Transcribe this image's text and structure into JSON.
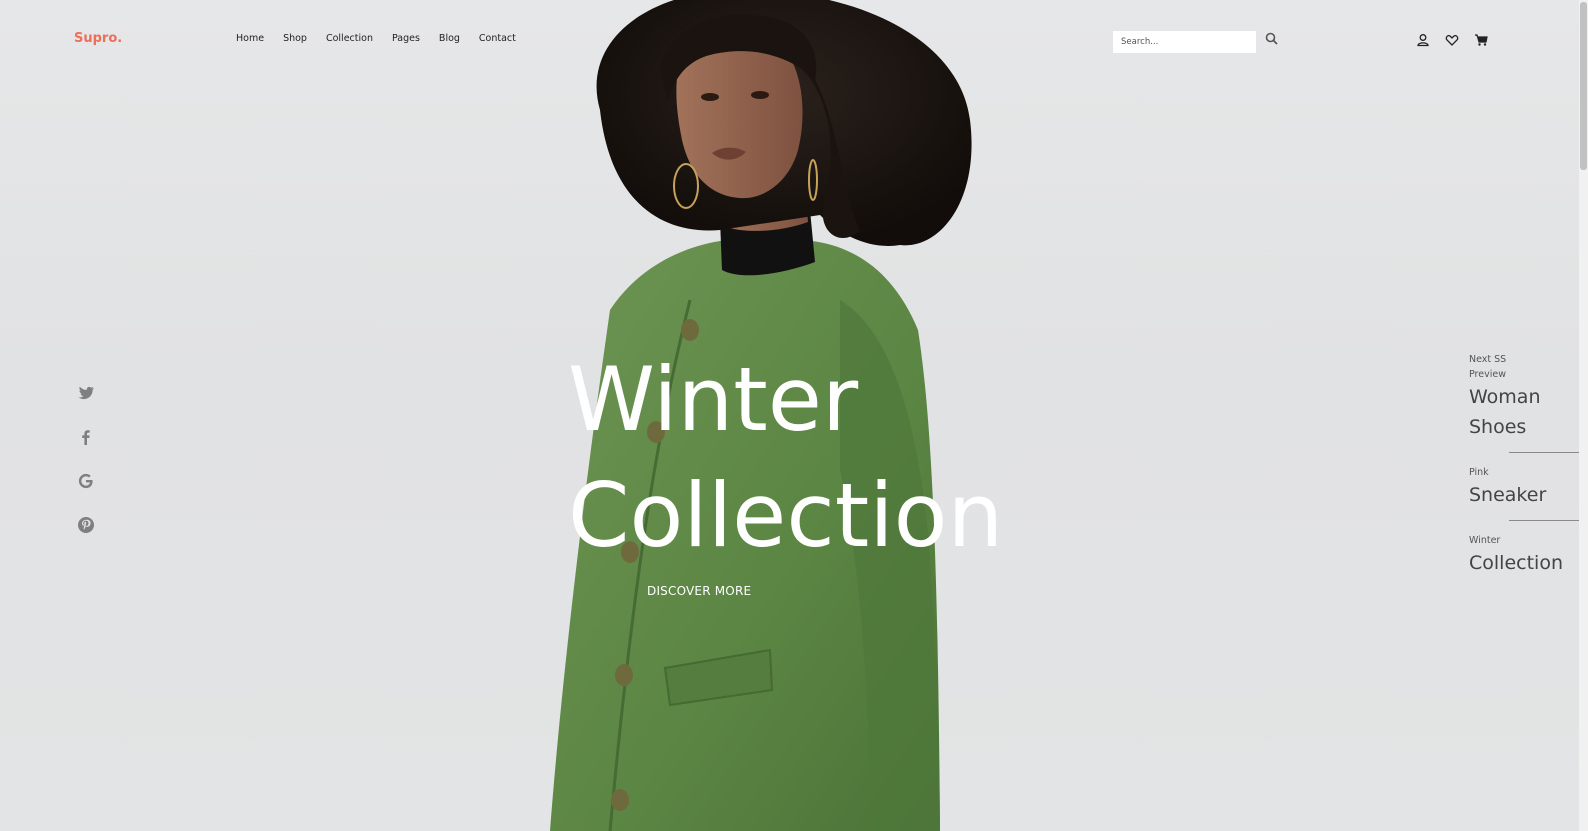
{
  "header": {
    "logo": "Supro.",
    "nav": [
      "Home",
      "Shop",
      "Collection",
      "Pages",
      "Blog",
      "Contact"
    ],
    "search_placeholder": "Search...",
    "icons": [
      "user-icon",
      "heart-icon",
      "cart-icon"
    ]
  },
  "social": {
    "icons": [
      "twitter-icon",
      "facebook-icon",
      "google-icon",
      "pinterest-icon"
    ]
  },
  "hero": {
    "title_line1": "Winter",
    "title_line2": "Collection",
    "cta": "DISCOVER MORE"
  },
  "slides": [
    {
      "kicker": "Next SS Preview",
      "label": "Woman Shoes"
    },
    {
      "kicker": "Pink",
      "label": "Sneaker"
    },
    {
      "kicker": "Winter",
      "label": "Collection"
    }
  ],
  "colors": {
    "logo": "#ef6e5a",
    "background": "#e3e4e5",
    "coat": "#5f8a47",
    "hero_text": "#ffffff"
  }
}
